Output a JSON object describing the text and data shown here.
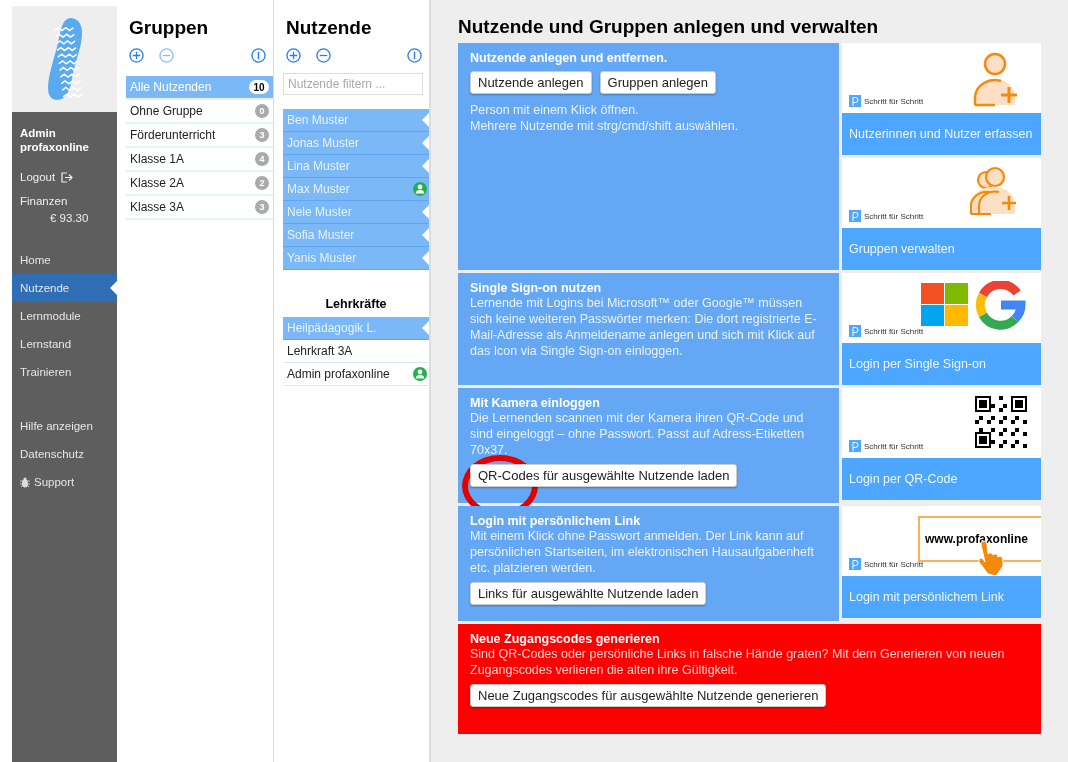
{
  "sidebar": {
    "user": "Admin profaxonline",
    "logout": "Logout",
    "finance_label": "Finanzen",
    "balance": "€ 93.30",
    "nav": [
      {
        "label": "Home",
        "selected": false
      },
      {
        "label": "Nutzende",
        "selected": true
      },
      {
        "label": "Lernmodule",
        "selected": false
      },
      {
        "label": "Lernstand",
        "selected": false
      },
      {
        "label": "Trainieren",
        "selected": false
      }
    ],
    "links": [
      {
        "label": "Hilfe anzeigen",
        "kind": "plain"
      },
      {
        "label": "Datenschutz",
        "kind": "plain"
      },
      {
        "label": "Support",
        "kind": "bug"
      }
    ]
  },
  "groups": {
    "title": "Gruppen",
    "items": [
      {
        "label": "Alle Nutzenden",
        "count": "10",
        "selected": true
      },
      {
        "label": "Ohne Gruppe",
        "count": "0",
        "selected": false
      },
      {
        "label": "Förderunterricht",
        "count": "3",
        "selected": false
      },
      {
        "label": "Klasse 1A",
        "count": "4",
        "selected": false
      },
      {
        "label": "Klasse 2A",
        "count": "2",
        "selected": false
      },
      {
        "label": "Klasse 3A",
        "count": "3",
        "selected": false
      }
    ]
  },
  "users": {
    "title": "Nutzende",
    "filter": {
      "placeholder": "Nutzende filtern ..."
    },
    "items": [
      {
        "name": "Ben Muster",
        "selected": true,
        "current": false
      },
      {
        "name": "Jonas Muster",
        "selected": true,
        "current": false
      },
      {
        "name": "Lina Muster",
        "selected": true,
        "current": false
      },
      {
        "name": "Max Muster",
        "selected": true,
        "current": true
      },
      {
        "name": "Nele Muster",
        "selected": true,
        "current": false
      },
      {
        "name": "Sofia Muster",
        "selected": true,
        "current": false
      },
      {
        "name": "Yanis Muster",
        "selected": true,
        "current": false
      }
    ],
    "teachers_heading": "Lehrkräfte",
    "teachers": [
      {
        "name": "Heilpädagogik L.",
        "selected": true,
        "current": false
      },
      {
        "name": "Lehrkraft 3A",
        "selected": false,
        "current": false
      },
      {
        "name": "Admin profaxonline",
        "selected": false,
        "current": true
      }
    ]
  },
  "main": {
    "title": "Nutzende und Gruppen anlegen und verwalten",
    "sections": [
      {
        "kind": "info",
        "title": "Nutzende anlegen und entfernen.",
        "text": [
          "Person mit einem Klick öffnen.",
          "Mehrere Nutzende mit strg/cmd/shift auswählen."
        ],
        "buttons": [
          "Nutzende anlegen",
          "Gruppen anlegen"
        ],
        "highlighted": false,
        "tiles": [
          {
            "kind": "user-add",
            "brand": "Schritt für Schritt",
            "caption": "Nutzerinnen und Nutzer erfassen"
          },
          {
            "kind": "group-add",
            "brand": "Schritt für Schritt",
            "caption": "Gruppen verwalten"
          }
        ]
      },
      {
        "kind": "info",
        "title": "Single Sign-on nutzen",
        "text": [
          "Lernende mit Logins bei Microsoft™ oder Google™ müssen sich keine weiteren Passwörter merken: Die dort registrierte E-Mail-Adresse als Anmeldename anlegen und sich mit Klick auf das Icon via Single Sign-on einloggen."
        ],
        "highlighted": false,
        "tiles": [
          {
            "kind": "sso",
            "brand": "Schritt für Schritt",
            "caption": "Login per Single Sign-on"
          }
        ]
      },
      {
        "kind": "info",
        "title": "Mit Kamera einloggen",
        "text": [
          "Die Lernenden scannen mit der Kamera ihren QR-Code und sind eingeloggt – ohne Passwort. Passt auf Adress-Etiketten 70x37."
        ],
        "buttons": [
          "QR-Codes für ausgewählte Nutzende laden"
        ],
        "highlighted": true,
        "tiles": [
          {
            "kind": "qr",
            "brand": "Schritt für Schritt",
            "caption": "Login per QR-Code"
          }
        ]
      },
      {
        "kind": "info",
        "title": "Login mit persönlichem Link",
        "text": [
          "Mit einem Klick ohne Passwort anmelden. Der Link kann auf persönlichen Startseiten, im elektronischen Hausaufgabenheft etc. platzieren werden."
        ],
        "buttons": [
          "Links für ausgewählte Nutzende laden"
        ],
        "highlighted": false,
        "tiles": [
          {
            "kind": "link",
            "brand": "Schritt für Schritt",
            "caption": "Login mit persönlichem Link",
            "url": "www.profaxonline"
          }
        ]
      },
      {
        "kind": "warning",
        "title": "Neue Zugangscodes generieren",
        "text": [
          "Sind QR-Codes oder persönliche Links in falsche Hände graten? Mit dem Generieren von neuen Zugangscodes verlieren die alten ihre Gültigkeit."
        ],
        "buttons": [
          "Neue Zugangscodes für ausgewählte Nutzende generieren"
        ],
        "highlighted": false
      }
    ]
  }
}
